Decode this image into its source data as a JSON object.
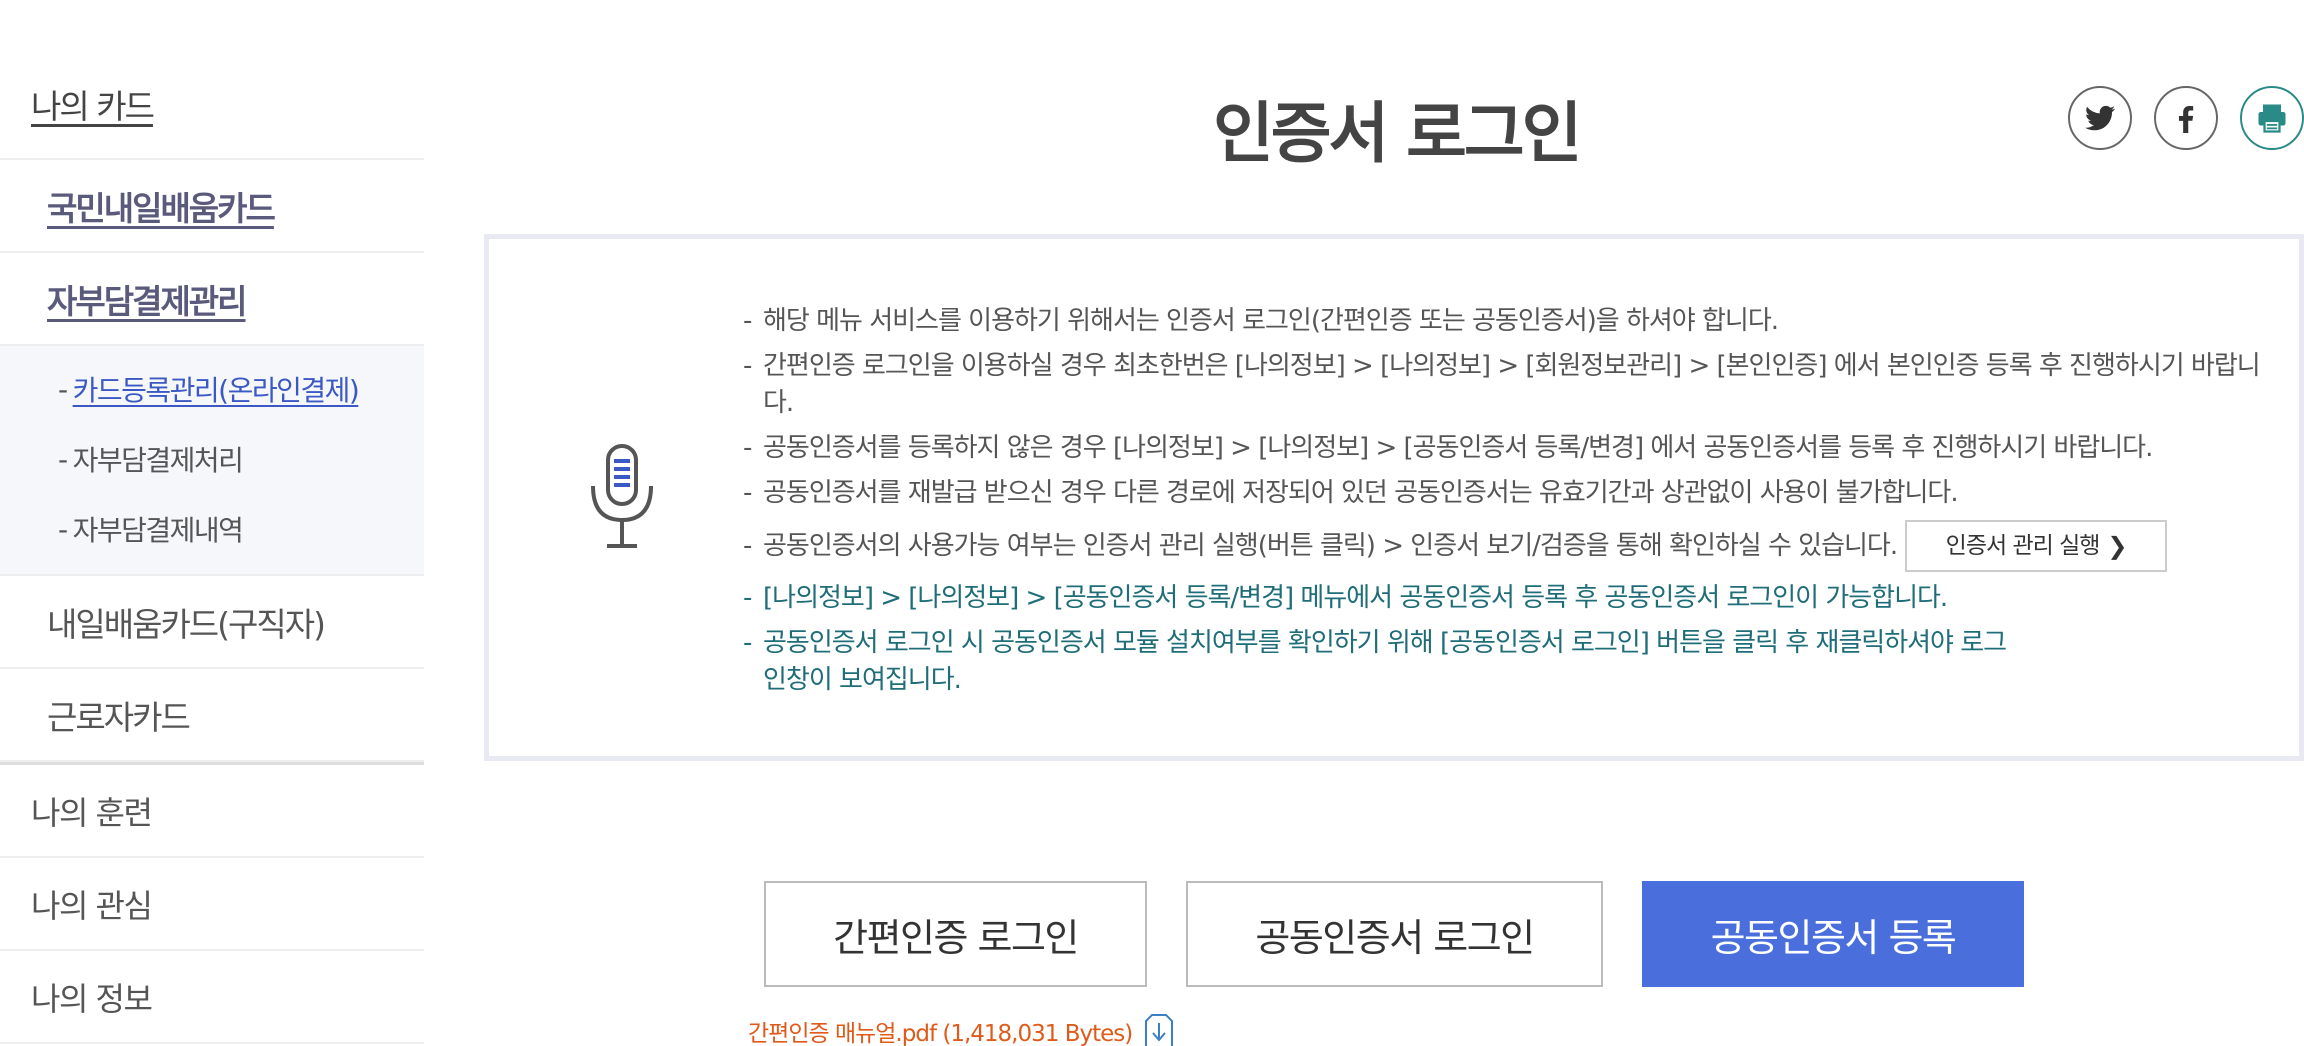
{
  "sidebar": {
    "top": "나의 카드",
    "sub1": "국민내일배움카드",
    "sub2": "자부담결제관리",
    "leaves": [
      {
        "dash": "-",
        "label": "카드등록관리(온라인결제)"
      },
      {
        "dash": "-",
        "label": "자부담결제처리"
      },
      {
        "dash": "-",
        "label": "자부담결제내역"
      }
    ],
    "sub3": "내일배움카드(구직자)",
    "sub4": "근로자카드",
    "main": [
      "나의 훈련",
      "나의 관심",
      "나의 정보"
    ]
  },
  "page_title": "인증서 로그인",
  "share": {
    "twitter": "twitter-icon",
    "facebook": "facebook-icon",
    "print": "print-icon"
  },
  "notes": [
    {
      "dash": "-",
      "text": "해당 메뉴 서비스를 이용하기 위해서는 인증서 로그인(간편인증 또는 공동인증서)을 하셔야 합니다."
    },
    {
      "dash": "-",
      "text": "간편인증 로그인을 이용하실 경우 최초한번은 [나의정보] > [나의정보] > [회원정보관리] > [본인인증] 에서 본인인증 등록 후 진행하시기 바랍니다."
    },
    {
      "dash": "-",
      "text": "공동인증서를 등록하지 않은 경우 [나의정보] > [나의정보] > [공동인증서 등록/변경] 에서 공동인증서를 등록 후 진행하시기 바랍니다."
    },
    {
      "dash": "-",
      "text": "공동인증서를 재발급 받으신 경우 다른 경로에 저장되어 있던 공동인증서는 유효기간과 상관없이 사용이 불가합니다."
    },
    {
      "dash": "-",
      "text": "공동인증서의 사용가능 여부는 인증서 관리 실행(버튼 클릭) > 인증서 보기/검증을 통해 확인하실 수 있습니다."
    }
  ],
  "cert_button": {
    "label": "인증서 관리 실행",
    "chevron": "❯"
  },
  "green_notes": [
    {
      "dash": "-",
      "text": "[나의정보] > [나의정보] > [공동인증서 등록/변경] 메뉴에서 공동인증서 등록 후 공동인증서 로그인이 가능합니다."
    },
    {
      "dash": "-",
      "text": "공동인증서 로그인 시 공동인증서 모듈 설치여부를 확인하기 위해 [공동인증서 로그인] 버튼을 클릭 후 재클릭하셔야 로그인창이 보여집니다."
    }
  ],
  "buttons": {
    "simple_login": "간편인증 로그인",
    "cert_login": "공동인증서 로그인",
    "cert_register": "공동인증서 등록"
  },
  "download": {
    "text": "간편인증 매뉴얼.pdf (1,418,031 Bytes)"
  },
  "colors": {
    "accent": "#4a6fdc",
    "link": "#3b58c4",
    "green": "#1f6d78",
    "download": "#e05a1a"
  }
}
